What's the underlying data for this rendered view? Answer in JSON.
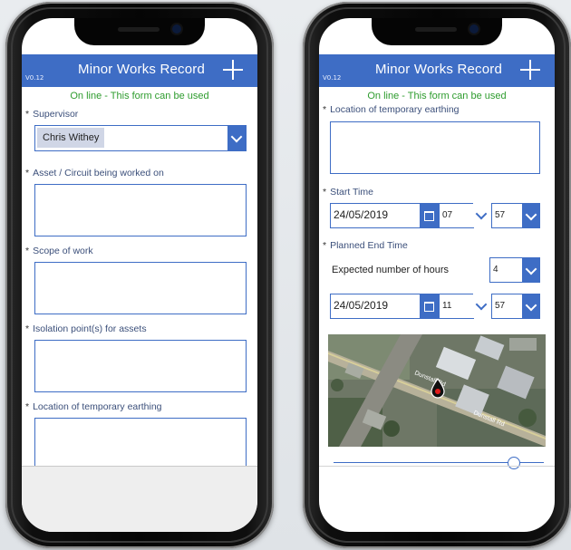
{
  "left_phone": {
    "header": {
      "version": "V0.12",
      "title": "Minor Works Record"
    },
    "status": "On line - This form can be used",
    "supervisor": {
      "label": "Supervisor",
      "value": "Chris Withey"
    },
    "asset": {
      "label": "Asset / Circuit being worked on"
    },
    "scope": {
      "label": "Scope of work"
    },
    "isolation": {
      "label": "Isolation point(s) for assets"
    },
    "earthing": {
      "label": "Location of temporary earthing"
    }
  },
  "right_phone": {
    "header": {
      "version": "V0.12",
      "title": "Minor Works Record"
    },
    "status": "On line - This form can be used",
    "earthing": {
      "label": "Location of temporary earthing"
    },
    "start_time": {
      "label": "Start Time",
      "date": "24/05/2019",
      "hour": "07",
      "minute": "57"
    },
    "planned_end": {
      "label": "Planned End Time",
      "expected_hours_label": "Expected number of hours",
      "expected_hours": "4",
      "date": "24/05/2019",
      "hour": "11",
      "minute": "57"
    },
    "map": {
      "road_label_1": "Dunstall Rd",
      "road_label_2": "Dunstall Rd"
    },
    "slider": {
      "level": 0.9
    }
  },
  "colors": {
    "accent": "#3e6dc5",
    "status_green": "#2e9c2e"
  },
  "icons": [
    "plus-icon",
    "chevron-down-icon",
    "calendar-icon",
    "map-pin-icon"
  ]
}
